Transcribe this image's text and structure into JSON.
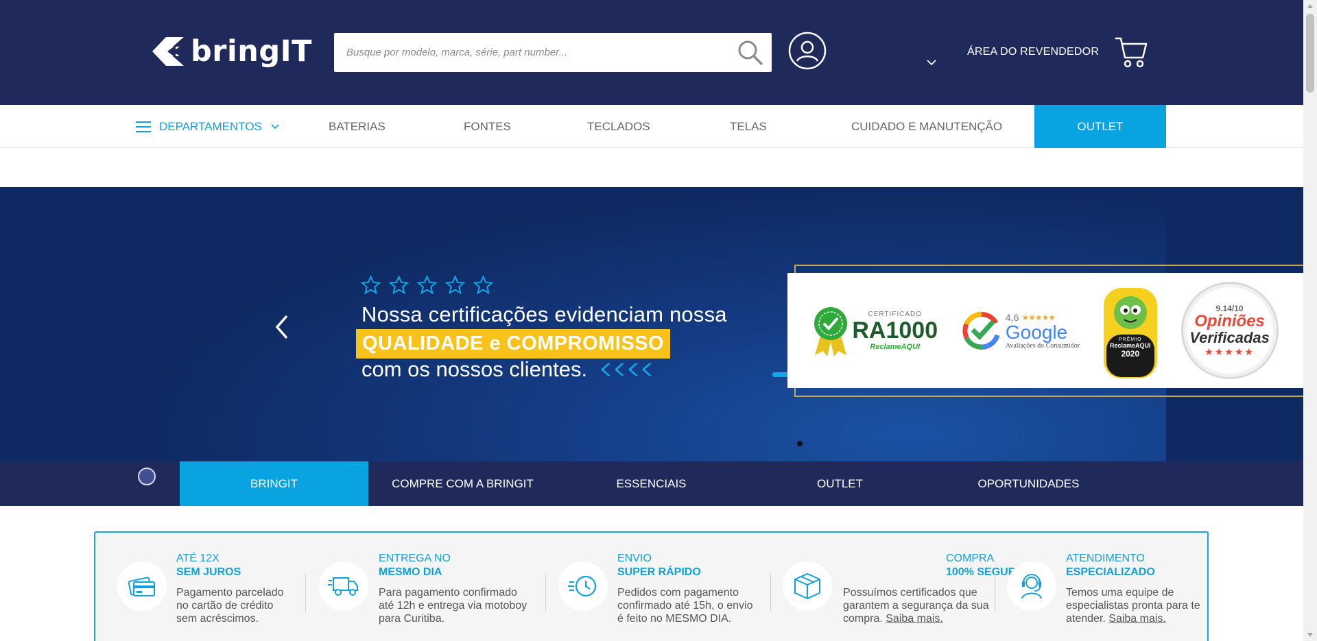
{
  "header": {
    "logo_text": "bringIT",
    "search_placeholder": "Busque por modelo, marca, série, part number...",
    "reseller_label": "ÁREA DO REVENDEDOR"
  },
  "nav": {
    "departments_label": "DEPARTAMENTOS",
    "items": [
      "BATERIAS",
      "FONTES",
      "TECLADOS",
      "TELAS",
      "CUIDADO E MANUTENÇÃO"
    ],
    "outlet_label": "OUTLET"
  },
  "hero": {
    "star_count": 5,
    "line1": "Nossa certificações evidenciam nossa",
    "highlight": "QUALIDADE e COMPROMISSO",
    "line3": "com os nossos clientes.",
    "certs": {
      "ra_small": "CERTIFICADO",
      "ra_big": "RA1000",
      "ra_sub": "ReclameAQUI",
      "google_rating": "4,6",
      "google_name": "Google",
      "google_sub": "Avaliações do Consumidor",
      "premio_top": "PRÊMIO",
      "premio_name": "ReclameAQUI",
      "premio_year": "2020",
      "opinioes_score": "9.14/10",
      "opinioes_line1": "Opiniões",
      "opinioes_line2": "Verificadas"
    },
    "colors": {
      "highlight": "#f8c21a",
      "accent": "#12a8e8"
    }
  },
  "category_tabs": [
    "BRINGIT",
    "COMPRE COM A BRINGIT",
    "ESSENCIAIS",
    "OUTLET",
    "OPORTUNIDADES"
  ],
  "category_active_index": 0,
  "benefits": [
    {
      "icon": "credit-card-icon",
      "title": "ATÉ 12X",
      "subtitle": "SEM JUROS",
      "desc": "Pagamento parcelado no cartão de crédito sem acréscimos.",
      "link": ""
    },
    {
      "icon": "delivery-truck-icon",
      "title": "ENTREGA NO",
      "subtitle": "MESMO DIA",
      "desc": "Para pagamento confirmado até 12h e entrega via motoboy para Curitiba.",
      "link": ""
    },
    {
      "icon": "fast-clock-icon",
      "title": "ENVIO",
      "subtitle": "SUPER RÁPIDO",
      "desc": "Pedidos com pagamento confirmado até 15h, o envio é feito no MESMO DIA.",
      "link": ""
    },
    {
      "icon": "package-box-icon",
      "title": "COMPRA",
      "subtitle": "100% SEGURA",
      "desc": "Possuímos certificados que garantem a segurança da sua compra.",
      "link": "Saiba mais."
    },
    {
      "icon": "headset-agent-icon",
      "title": "ATENDIMENTO",
      "subtitle": "ESPECIALIZADO",
      "desc": "Temos uma equipe de especialistas pronta para te atender.",
      "link": "Saiba mais."
    }
  ],
  "colors": {
    "header_bg": "#1f2a5b",
    "accent": "#08a3e0",
    "hero_bg": "#0f2a63"
  }
}
